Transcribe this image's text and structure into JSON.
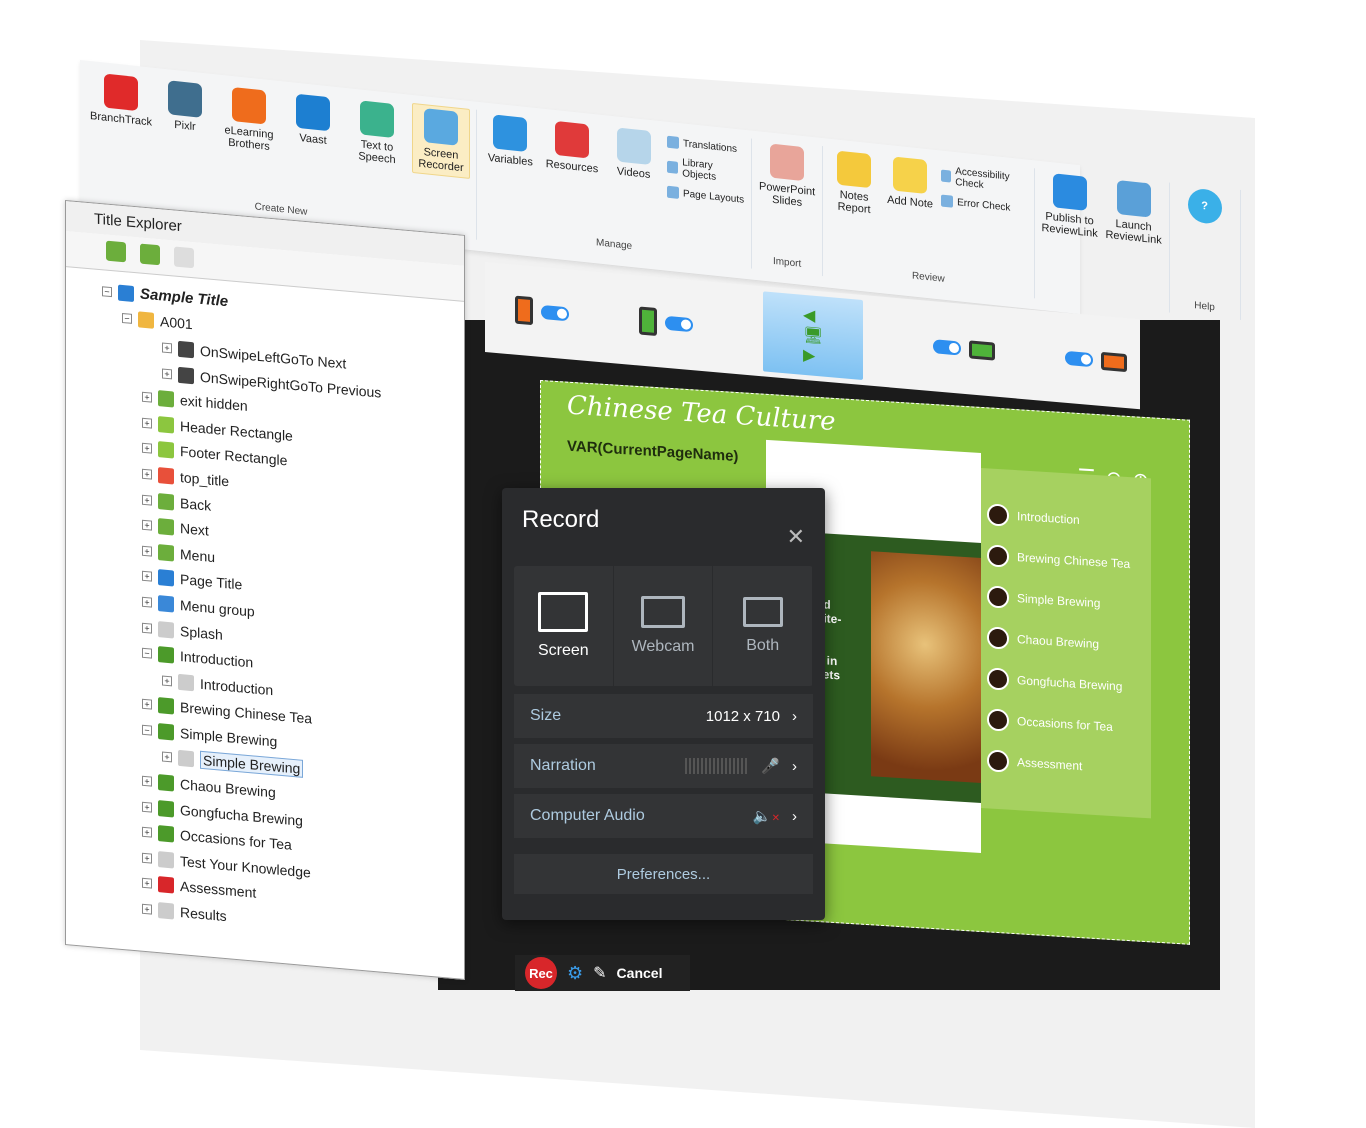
{
  "ribbon": {
    "groups": [
      {
        "label": "Create New",
        "items": [
          {
            "label": "BranchTrack",
            "icon": "branchtrack-icon",
            "color": "#e02a2a"
          },
          {
            "label": "Pixlr",
            "icon": "pixlr-icon",
            "color": "#3f6e8e"
          },
          {
            "label": "eLearning Brothers",
            "icon": "elearning-brothers-icon",
            "color": "#ef6c1c"
          },
          {
            "label": "Vaast",
            "icon": "vaast-icon",
            "color": "#1d7fd1"
          },
          {
            "label": "Text to Speech",
            "icon": "text-to-speech-icon",
            "color": "#3bb28d"
          },
          {
            "label": "Screen Recorder",
            "icon": "screen-recorder-icon",
            "color": "#5aa9e0",
            "selected": true
          }
        ]
      },
      {
        "label": "Manage",
        "items": [
          {
            "label": "Variables",
            "icon": "variables-icon",
            "color": "#2e92df"
          },
          {
            "label": "Resources",
            "icon": "resources-icon",
            "color": "#e03a3a"
          },
          {
            "label": "Videos",
            "icon": "videos-icon",
            "color": "#b6d5ea"
          }
        ],
        "small": [
          "Translations",
          "Library Objects",
          "Page Layouts"
        ]
      },
      {
        "label": "Import",
        "items": [
          {
            "label": "PowerPoint Slides",
            "icon": "powerpoint-icon",
            "color": "#e8a59a"
          }
        ]
      },
      {
        "label": "Review",
        "items": [
          {
            "label": "Notes Report",
            "icon": "notes-report-icon",
            "color": "#f4c93c"
          },
          {
            "label": "Add Note",
            "icon": "add-note-icon",
            "color": "#f6d24a"
          }
        ],
        "small": [
          "Accessibility Check",
          "Error Check"
        ]
      },
      {
        "label": "",
        "items": [
          {
            "label": "Publish to ReviewLink",
            "icon": "publish-reviewlink-icon",
            "color": "#2b8be0"
          },
          {
            "label": "Launch ReviewLink",
            "icon": "launch-reviewlink-icon",
            "color": "#5aa0d8"
          }
        ]
      },
      {
        "label": "Help",
        "items": [
          {
            "label": "",
            "icon": "help-icon",
            "color": "#3ab0e8"
          }
        ]
      }
    ]
  },
  "explorer": {
    "title": "Title Explorer",
    "nodes": [
      {
        "label": "Sample Title",
        "depth": 0,
        "color": "#2a7fd4",
        "bold": true
      },
      {
        "label": "A001",
        "depth": 1,
        "color": "#f0b640"
      },
      {
        "label": "OnSwipeLeftGoTo Next",
        "depth": 3,
        "color": "#444"
      },
      {
        "label": "OnSwipeRightGoTo Previous",
        "depth": 3,
        "color": "#444"
      },
      {
        "label": "exit hidden",
        "depth": 2,
        "color": "#6cae3c"
      },
      {
        "label": "Header Rectangle",
        "depth": 2,
        "color": "#8cc63f"
      },
      {
        "label": "Footer Rectangle",
        "depth": 2,
        "color": "#8cc63f"
      },
      {
        "label": "top_title",
        "depth": 2,
        "color": "#e8503a"
      },
      {
        "label": "Back",
        "depth": 2,
        "color": "#6cae3c"
      },
      {
        "label": "Next",
        "depth": 2,
        "color": "#6cae3c"
      },
      {
        "label": "Menu",
        "depth": 2,
        "color": "#6cae3c"
      },
      {
        "label": "Page Title",
        "depth": 2,
        "color": "#2a7fd4"
      },
      {
        "label": "Menu group",
        "depth": 2,
        "color": "#3a88d8"
      },
      {
        "label": "Splash",
        "depth": 2,
        "color": "#ccc"
      },
      {
        "label": "Introduction",
        "depth": 2,
        "color": "#4c9a2a"
      },
      {
        "label": "Introduction",
        "depth": 3,
        "color": "#ccc"
      },
      {
        "label": "Brewing Chinese Tea",
        "depth": 2,
        "color": "#4c9a2a"
      },
      {
        "label": "Simple Brewing",
        "depth": 2,
        "color": "#4c9a2a"
      },
      {
        "label": "Simple Brewing",
        "depth": 3,
        "color": "#ccc",
        "highlight": true
      },
      {
        "label": "Chaou Brewing",
        "depth": 2,
        "color": "#4c9a2a"
      },
      {
        "label": "Gongfucha Brewing",
        "depth": 2,
        "color": "#4c9a2a"
      },
      {
        "label": "Occasions for Tea",
        "depth": 2,
        "color": "#4c9a2a"
      },
      {
        "label": "Test Your Knowledge",
        "depth": 2,
        "color": "#ccc"
      },
      {
        "label": "Assessment",
        "depth": 2,
        "color": "#d8262a"
      },
      {
        "label": "Results",
        "depth": 2,
        "color": "#ccc"
      }
    ]
  },
  "slide": {
    "title": "Chinese Tea Culture",
    "var": "VAR(CurrentPageName)",
    "body_fragments": [
      "a",
      "od",
      "bite-",
      "",
      "",
      "d in",
      "kets"
    ],
    "menu": [
      "Introduction",
      "Brewing Chinese Tea",
      "Simple Brewing",
      "Chaou Brewing",
      "Gongfucha Brewing",
      "Occasions for Tea",
      "Assessment"
    ]
  },
  "record": {
    "title": "Record",
    "modes": [
      {
        "label": "Screen",
        "active": true
      },
      {
        "label": "Webcam"
      },
      {
        "label": "Both"
      }
    ],
    "size_label": "Size",
    "size_value": "1012 x 710",
    "narration_label": "Narration",
    "audio_label": "Computer Audio",
    "preferences": "Preferences..."
  },
  "recbar": {
    "rec": "Rec",
    "cancel": "Cancel"
  }
}
